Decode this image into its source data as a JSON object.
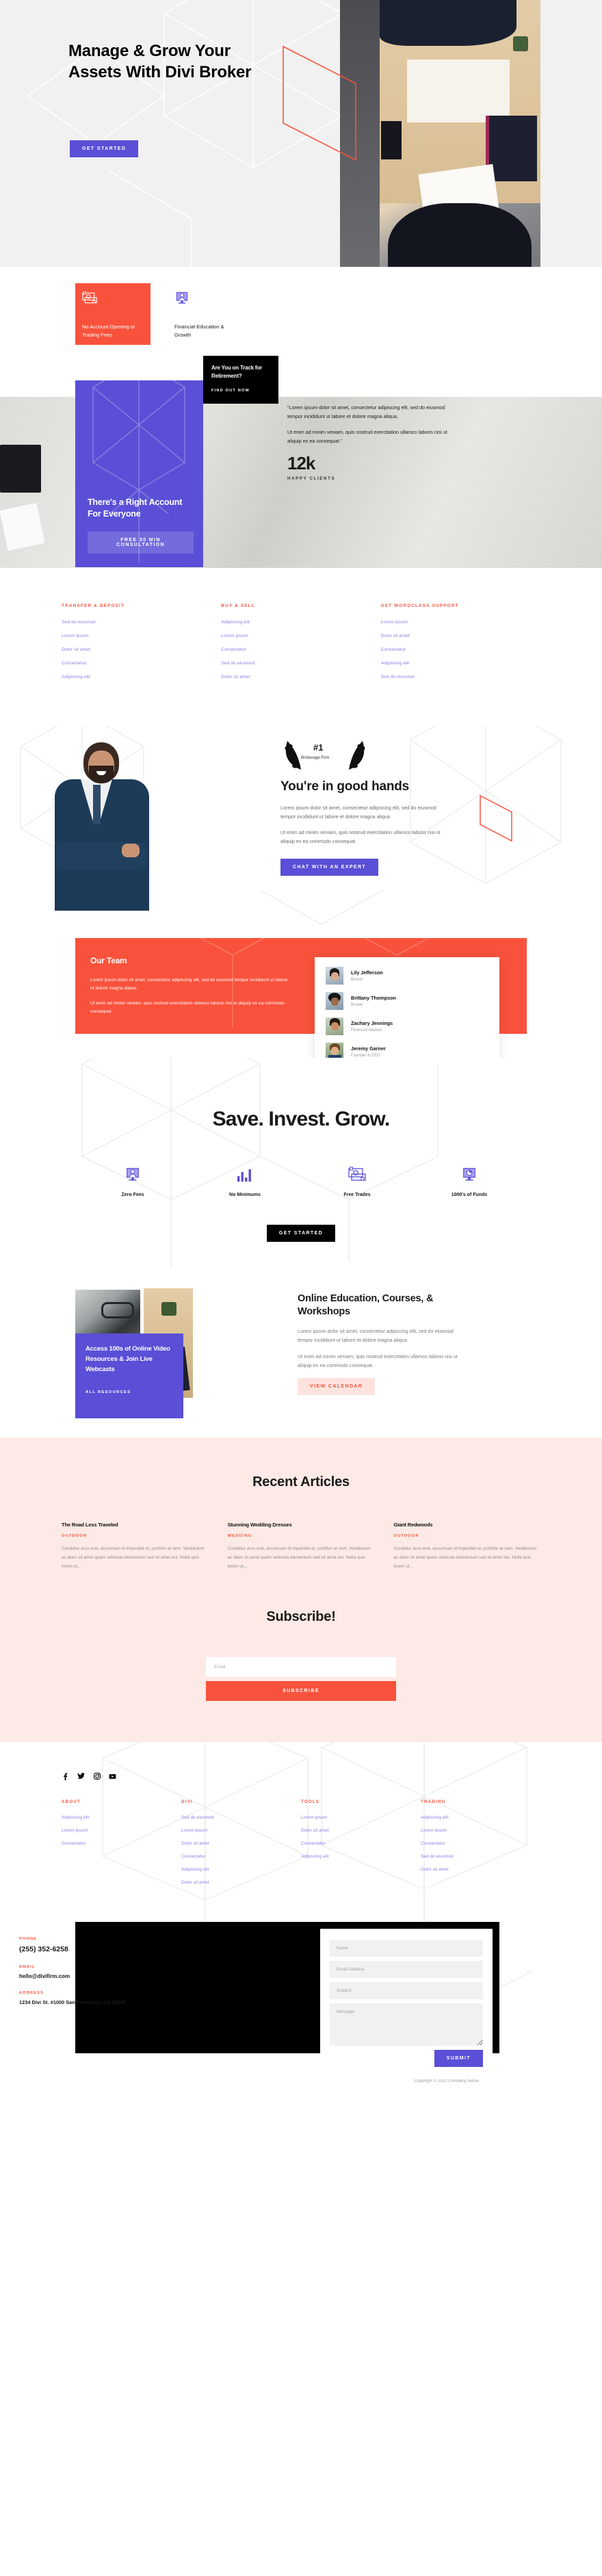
{
  "hero": {
    "title": "Manage & Grow Your Assets With Divi Broker",
    "cta": "GET STARTED",
    "image_alt": "two-people-at-desk-photo"
  },
  "features": [
    {
      "icon": "money-exchange-icon",
      "label": "No Account Opening or Trading Fees"
    },
    {
      "icon": "person-monitor-icon",
      "label": "Financial Education & Growth"
    }
  ],
  "account_band": {
    "purple_card": {
      "title": "There's a Right Account For Everyone",
      "cta": "FREE 30 MIN CONSULTATION"
    },
    "black_card": {
      "title": "Are You on Track for Retirement?",
      "link": "FIND OUT NOW"
    },
    "quote_p1": "\"Lorem ipsum dolor sit amet, consectetur adipiscing elit, sed do eiusmod tempor incididunt ut labore et dolore magna aliqua.",
    "quote_p2": "Ut enim ad minim veniam, quis nostrud exercitation ullamco laboris nisi ut aliquip ex ea consequat.\"",
    "stat_number": "12k",
    "stat_label": "HAPPY CLIENTS"
  },
  "link_columns": [
    {
      "heading": "TRANSFER & DEPOSIT",
      "links": [
        "Sed do eiusmod",
        "Lorem ipsum",
        "Dolor sit amet",
        "Consectetur",
        "Adipiscing elit"
      ]
    },
    {
      "heading": "BUY & SELL",
      "links": [
        "Adipiscing elit",
        "Lorem ipsum",
        "Consectetur",
        "Sed do eiusmod",
        "Dolor sit amet"
      ]
    },
    {
      "heading": "GET WORDCLASS SUPPORT",
      "links": [
        "Lorem ipsum",
        "Dolor sit amet",
        "Consectetur",
        "Adipiscing elit",
        "Sed do eiusmod"
      ]
    }
  ],
  "good_hands": {
    "badge_number": "#1",
    "badge_sub": "Brokerage Firm",
    "title": "You're in good hands",
    "p1": "Lorem ipsum dolor sit amet, consectetur adipiscing elit, sed do eiusmod tempor incididunt ut labore et dolore magna aliqua.",
    "p2": "Ut enim ad minim veniam, quis nostrud exercitation ullamco laboris nisi ut aliquip ex ea commodo consequat.",
    "cta": "CHAT WITH AN EXPERT",
    "photo_alt": "businessman-arms-crossed-photo"
  },
  "team": {
    "title": "Our Team",
    "p1": "Lorem ipsum dolor sit amet, consectetur adipiscing elit, sed do eiusmod tempor incididunt ut labore et dolore magna aliqua.",
    "p2": "Ut enim ad minim veniam, quis nostrud exercitation ullamco laboris nisi ut aliquip ex ea commodo consequat.",
    "members": [
      {
        "name": "Lily Jefferson",
        "role": "Broker"
      },
      {
        "name": "Brittany Thompson",
        "role": "Broker"
      },
      {
        "name": "Zachary Jennings",
        "role": "Financial Advisor"
      },
      {
        "name": "Jeremy Garner",
        "role": "Founder & CEO"
      }
    ]
  },
  "save_invest_grow": {
    "title": "Save. Invest. Grow.",
    "items": [
      {
        "icon": "person-monitor-icon",
        "label": "Zero Fees"
      },
      {
        "icon": "bar-chart-icon",
        "label": "No Minimums"
      },
      {
        "icon": "money-exchange-icon",
        "label": "Free Trades"
      },
      {
        "icon": "pie-chart-monitor-icon",
        "label": "1000's of Funds"
      }
    ],
    "cta": "GET STARTED"
  },
  "education": {
    "title": "Online Education, Courses, & Workshops",
    "p1": "Lorem ipsum dolor sit amet, consectetur adipiscing elit, sed do eiusmod tempor incididunt ut labore et dolore magna aliqua.",
    "p2": "Ut enim ad minim veniam, quis nostrud exercitation ullamco laboris nisi ut aliquip ex ea commodo consequat.",
    "cta": "VIEW CALENDAR",
    "purple_card_title": "Access 100s of Online Video Resources & Join Live Webcasts",
    "purple_card_link": "ALL RESOURCES"
  },
  "articles": {
    "title": "Recent Articles",
    "items": [
      {
        "title": "The Road Less Traveled",
        "category": "OUTDOOR",
        "excerpt": "Curabitur arcu erat, accumsan id imperdiet et, porttitor at sem. Vestibulum ac diam sit amet quam vehicula elementum sed sit amet dui. Nulla quis lorem ut..."
      },
      {
        "title": "Stunning Wedding Dresses",
        "category": "WEDDING",
        "excerpt": "Curabitur arcu erat, accumsan id imperdiet et, porttitor at sem. Vestibulum ac diam sit amet quam vehicula elementum sed sit amet dui. Nulla quis lorem ut..."
      },
      {
        "title": "Giant Redwoods",
        "category": "OUTDOOR",
        "excerpt": "Curabitur arcu erat, accumsan id imperdiet et, porttitor at sem. Vestibulum ac diam sit amet quam vehicula elementum sed sit amet dui. Nulla quis lorem ut..."
      }
    ]
  },
  "subscribe": {
    "title": "Subscribe!",
    "email_placeholder": "Email",
    "email_value": "",
    "cta": "SUBSCRIBE"
  },
  "footer": {
    "social": [
      "facebook-icon",
      "twitter-icon",
      "instagram-icon",
      "youtube-icon"
    ],
    "columns": [
      {
        "heading": "ABOUT",
        "links": [
          "Adipiscing elit",
          "Lorem ipsum",
          "Consectetur"
        ]
      },
      {
        "heading": "DIVI",
        "links": [
          "Sed do eiusmod",
          "Lorem ipsum",
          "Dolor sit amet",
          "Consectetur",
          "Adipiscing elit",
          "Dolor sit amet"
        ]
      },
      {
        "heading": "TOOLS",
        "links": [
          "Lorem ipsum",
          "Dolor sit amet",
          "Consectetur",
          "Adipiscing elit"
        ]
      },
      {
        "heading": "TRADING",
        "links": [
          "Adipiscing elit",
          "Lorem ipsum",
          "Consectetur",
          "Sed do eiusmod",
          "Dolor sit amet"
        ]
      }
    ],
    "contact": {
      "phone_label": "PHONE",
      "phone": "(255) 352-6258",
      "email_label": "EMAIL",
      "email": "hello@divifirm.com",
      "address_label": "ADDRESS",
      "address": "1234 Divi St. #1000 San Francisco, CA 33945"
    },
    "form": {
      "name_placeholder": "Name",
      "name_value": "",
      "email_placeholder": "Email Address",
      "email_value": "",
      "subject_placeholder": "Subject",
      "subject_value": "",
      "message_placeholder": "Message",
      "message_value": "",
      "submit": "SUBMIT"
    },
    "copyright": "Copyright © 2021 Company Name"
  },
  "colors": {
    "purple": "#5a4fd6",
    "red": "#f9523c",
    "black": "#000000",
    "pale_pink": "#fdeae6",
    "link_purple": "#8a80e8",
    "hero_bg": "#f1f1f1"
  }
}
